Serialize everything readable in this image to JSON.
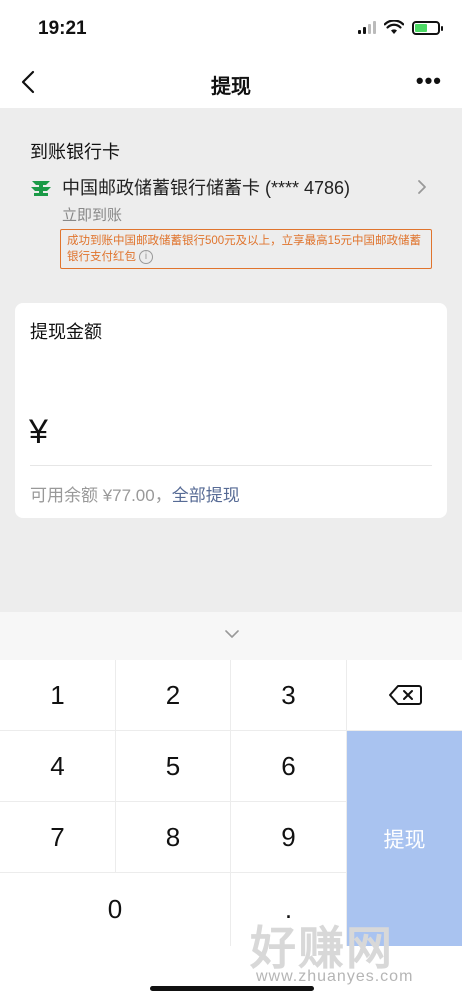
{
  "status_bar": {
    "time": "19:21"
  },
  "nav": {
    "title": "提现",
    "more": "•••"
  },
  "bank": {
    "heading": "到账银行卡",
    "card_name": "中国邮政储蓄银行储蓄卡 (**** 4786)",
    "arrival": "立即到账",
    "promo": "成功到账中国邮政储蓄银行500元及以上，立享最高15元中国邮政储蓄银行支付红包",
    "info_glyph": "i"
  },
  "amount": {
    "label": "提现金额",
    "currency": "¥",
    "value": "",
    "balance_text": "可用余额 ¥77.00，",
    "withdraw_all": "全部提现"
  },
  "keypad": {
    "keys": [
      "1",
      "2",
      "3",
      "4",
      "5",
      "6",
      "7",
      "8",
      "9",
      "0",
      "."
    ],
    "submit_label": "提现",
    "submit_color": "#a9c3f0"
  },
  "watermark": {
    "main": "好赚网",
    "sub": "www.zhuanyes.com"
  }
}
